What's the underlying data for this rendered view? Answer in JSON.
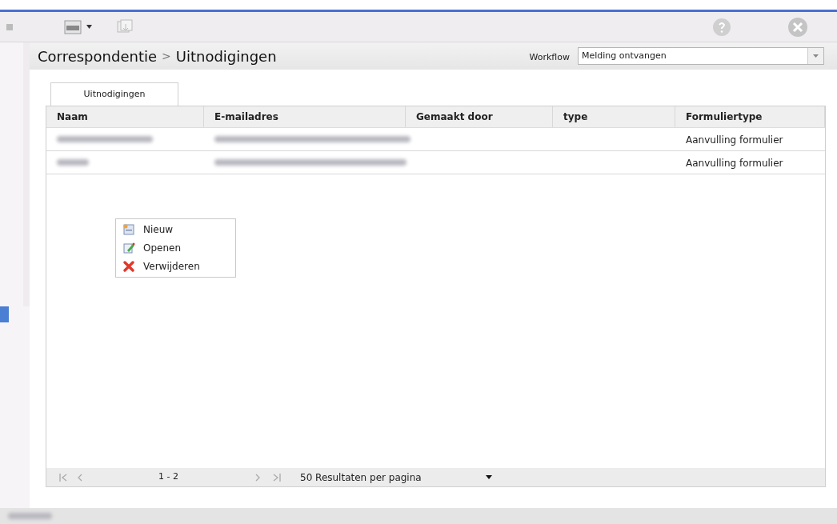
{
  "breadcrumb": {
    "parent": "Correspondentie",
    "separator": ">",
    "current": "Uitnodigingen"
  },
  "workflow": {
    "label": "Workflow",
    "value": "Melding ontvangen"
  },
  "tabs": [
    {
      "label": "Uitnodigingen",
      "selected": true
    }
  ],
  "table": {
    "columns": [
      "Naam",
      "E-mailadres",
      "Gemaakt door",
      "type",
      "Formuliertype"
    ],
    "rows": [
      {
        "naam_blurred": true,
        "email_blurred": true,
        "formuliertype": "Aanvulling formulier"
      },
      {
        "naam_blurred": true,
        "email_blurred": true,
        "formuliertype": "Aanvulling formulier"
      }
    ]
  },
  "context_menu": [
    {
      "kind": "new",
      "label": "Nieuw"
    },
    {
      "kind": "edit",
      "label": "Openen"
    },
    {
      "kind": "delete",
      "label": "Verwijderen"
    }
  ],
  "pager": {
    "range": "1 - 2",
    "page_size": "50 Resultaten per pagina"
  },
  "status_blurred": true
}
